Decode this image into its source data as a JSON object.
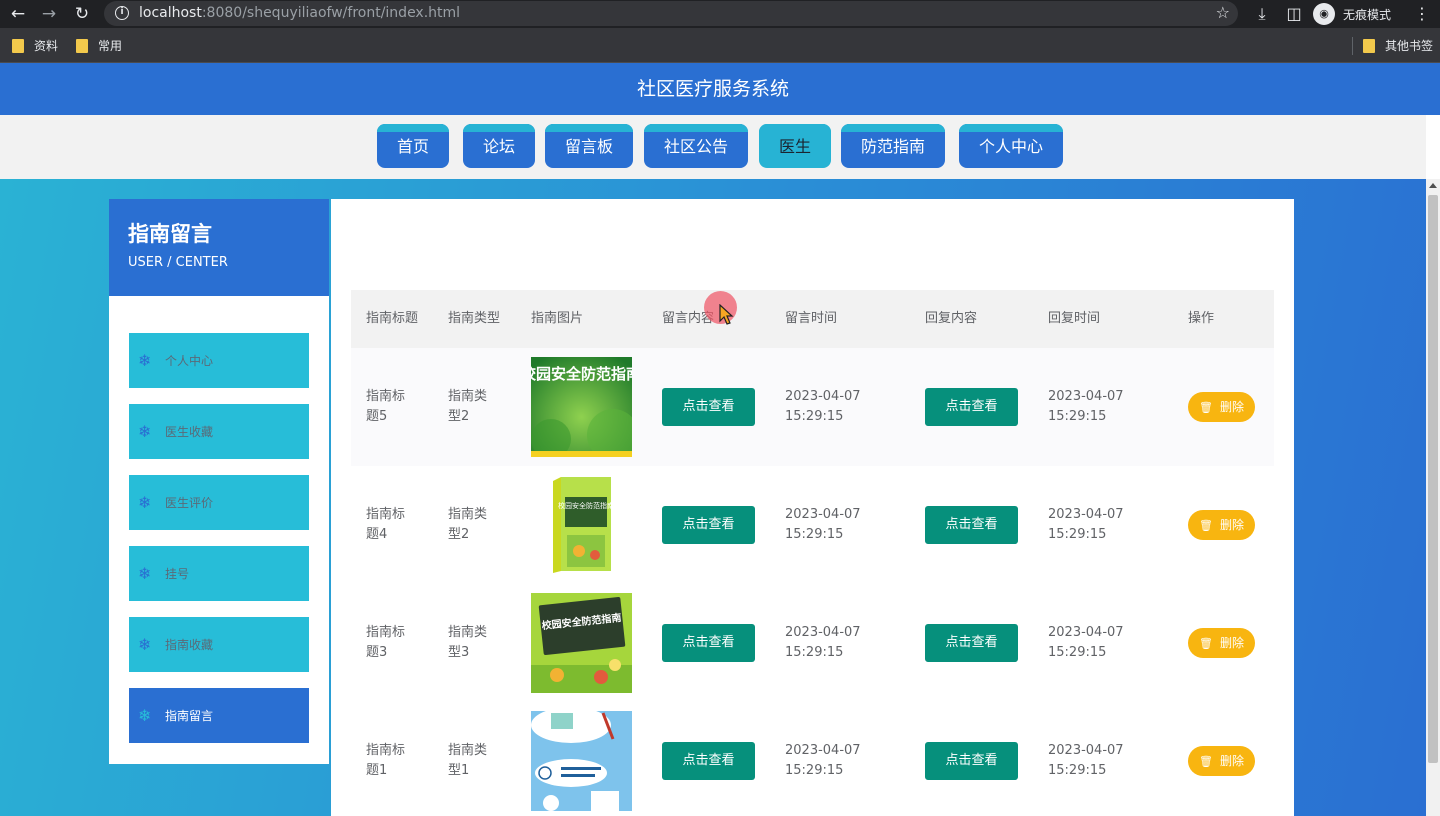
{
  "browser": {
    "url_host": "localhost",
    "url_rest": ":8080/shequyiliaofw/front/index.html",
    "profile_label": "无痕模式",
    "bookmarks": [
      "资料",
      "常用"
    ],
    "other_bookmarks": "其他书签"
  },
  "header": {
    "title": "社区医疗服务系统"
  },
  "nav": {
    "tabs": [
      "首页",
      "论坛",
      "留言板",
      "社区公告",
      "医生",
      "防范指南",
      "个人中心"
    ],
    "active": "医生"
  },
  "sidebar": {
    "title": "指南留言",
    "subtitle": "USER / CENTER",
    "items": [
      "个人中心",
      "医生收藏",
      "医生评价",
      "挂号",
      "指南收藏",
      "指南留言"
    ],
    "active": "指南留言"
  },
  "table": {
    "headers": [
      "指南标题",
      "指南类型",
      "指南图片",
      "留言内容",
      "留言时间",
      "回复内容",
      "回复时间",
      "操作"
    ],
    "rows": [
      {
        "title": "指南标题5",
        "type": "指南类型2",
        "image_text": "校园安全防范指南",
        "view_content": "点击查看",
        "msg_date": "2023-04-07",
        "msg_time": "15:29:15",
        "view_reply": "点击查看",
        "reply_date": "2023-04-07",
        "reply_time": "15:29:15",
        "delete": "删除"
      },
      {
        "title": "指南标题4",
        "type": "指南类型2",
        "image_text": "校园安全防范指南",
        "view_content": "点击查看",
        "msg_date": "2023-04-07",
        "msg_time": "15:29:15",
        "view_reply": "点击查看",
        "reply_date": "2023-04-07",
        "reply_time": "15:29:15",
        "delete": "删除"
      },
      {
        "title": "指南标题3",
        "type": "指南类型3",
        "image_text": "校园安全防范指南",
        "view_content": "点击查看",
        "msg_date": "2023-04-07",
        "msg_time": "15:29:15",
        "view_reply": "点击查看",
        "reply_date": "2023-04-07",
        "reply_time": "15:29:15",
        "delete": "删除"
      },
      {
        "title": "指南标题1",
        "type": "指南类型1",
        "image_text": "",
        "view_content": "点击查看",
        "msg_date": "2023-04-07",
        "msg_time": "15:29:15",
        "view_reply": "点击查看",
        "reply_date": "2023-04-07",
        "reply_time": "15:29:15",
        "delete": "删除"
      }
    ]
  },
  "icons": {
    "back": "arrow-left-icon",
    "forward": "arrow-right-icon",
    "reload": "reload-icon",
    "info": "info-icon",
    "star": "star-icon",
    "download": "download-icon",
    "panel": "side-panel-icon",
    "profile": "incognito-icon",
    "menu": "kebab-icon",
    "folder": "folder-icon",
    "snowflake": "snowflake-icon",
    "trash": "trash-icon"
  },
  "colors": {
    "primary_blue": "#2a6fd2",
    "accent_cyan": "#27b3d4",
    "view_button": "#06907c",
    "delete_button": "#f8b510"
  }
}
